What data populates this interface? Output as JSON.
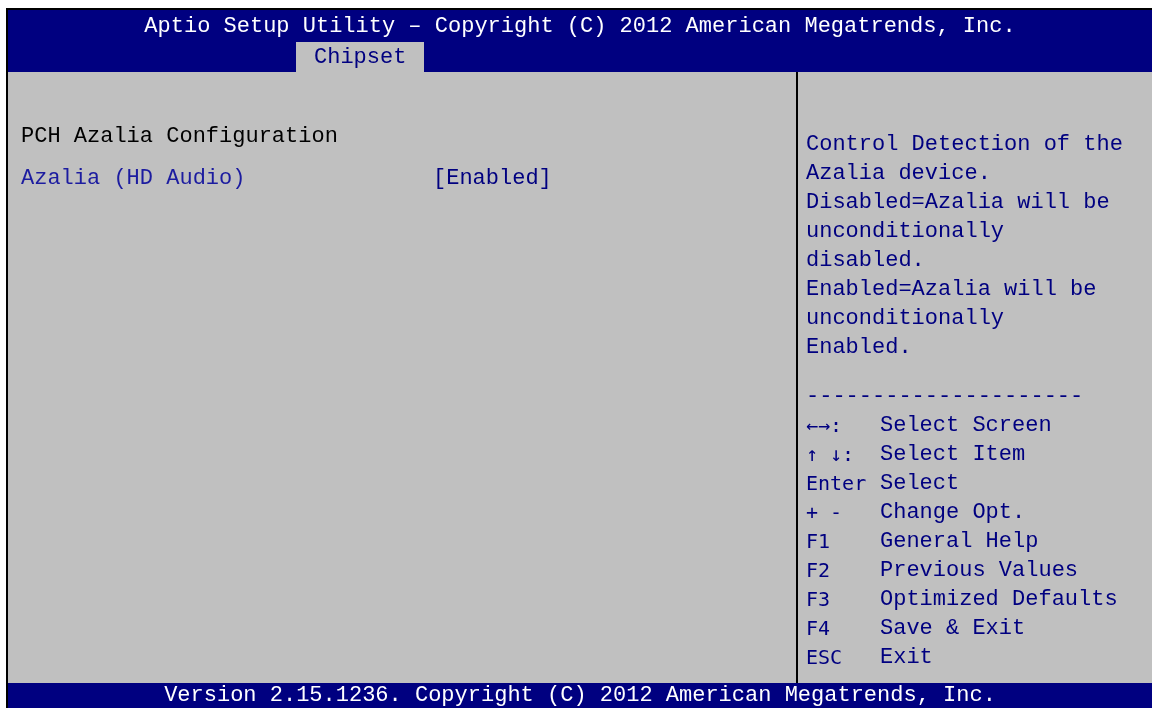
{
  "window": {
    "title": "Aptio Setup Utility – Copyright (C) 2012 American Megatrends, Inc."
  },
  "tabs": [
    {
      "label": "Chipset",
      "selected": true
    }
  ],
  "items": [
    {
      "kind": "heading",
      "label": "PCH Azalia Configuration"
    },
    {
      "kind": "setting",
      "label": "Azalia (HD Audio)",
      "value": "[Enabled]"
    }
  ],
  "help": {
    "description": [
      "Control Detection of the",
      "Azalia device.",
      "Disabled=Azalia will be",
      "unconditionally",
      "disabled.",
      "Enabled=Azalia will be",
      "unconditionally",
      "Enabled."
    ],
    "separator": "---------------------",
    "keys": [
      {
        "key": "←→:",
        "action": "Select Screen"
      },
      {
        "key": "↑ ↓:",
        "action": "Select Item"
      },
      {
        "key": "Enter",
        "action": "Select"
      },
      {
        "key": "+ -",
        "action": "Change Opt."
      },
      {
        "key": "F1",
        "action": "General Help"
      },
      {
        "key": "F2",
        "action": "Previous Values"
      },
      {
        "key": "F3",
        "action": "Optimized Defaults"
      },
      {
        "key": "F4",
        "action": "Save & Exit"
      },
      {
        "key": "ESC",
        "action": "Exit"
      }
    ]
  },
  "status_bar": "Version 2.15.1236. Copyright (C) 2012 American Megatrends, Inc."
}
